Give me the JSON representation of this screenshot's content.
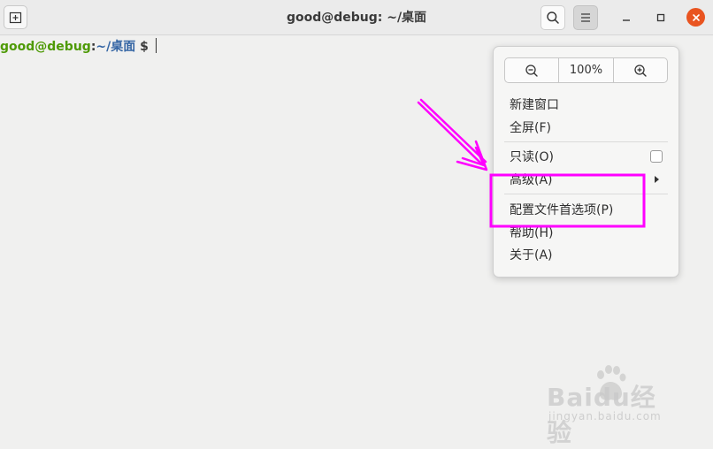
{
  "window": {
    "title": "good@debug: ~/桌面"
  },
  "terminal": {
    "prompt_user": "good@debug",
    "prompt_sep": ":",
    "prompt_path": "~/桌面",
    "prompt_symbol": "$"
  },
  "menu": {
    "zoom": {
      "zoom_out_icon": "zoom-out-icon",
      "level": "100%",
      "zoom_in_icon": "zoom-in-icon"
    },
    "items": [
      {
        "label": "新建窗口"
      },
      {
        "label": "全屏(F)"
      },
      {
        "label": "只读(O)",
        "control": "checkbox",
        "checked": false
      },
      {
        "label": "高级(A)",
        "control": "submenu-arrow"
      },
      {
        "label": "配置文件首选项(P)"
      },
      {
        "label": "帮助(H)"
      },
      {
        "label": "关于(A)"
      }
    ]
  },
  "annotation": {
    "color": "#ff00ff"
  },
  "watermark": {
    "logo": "Baidu经验",
    "url": "jingyan.baidu.com"
  },
  "colors": {
    "close_button": "#e95420",
    "prompt_user": "#4e9a06",
    "prompt_path": "#3465a4"
  }
}
